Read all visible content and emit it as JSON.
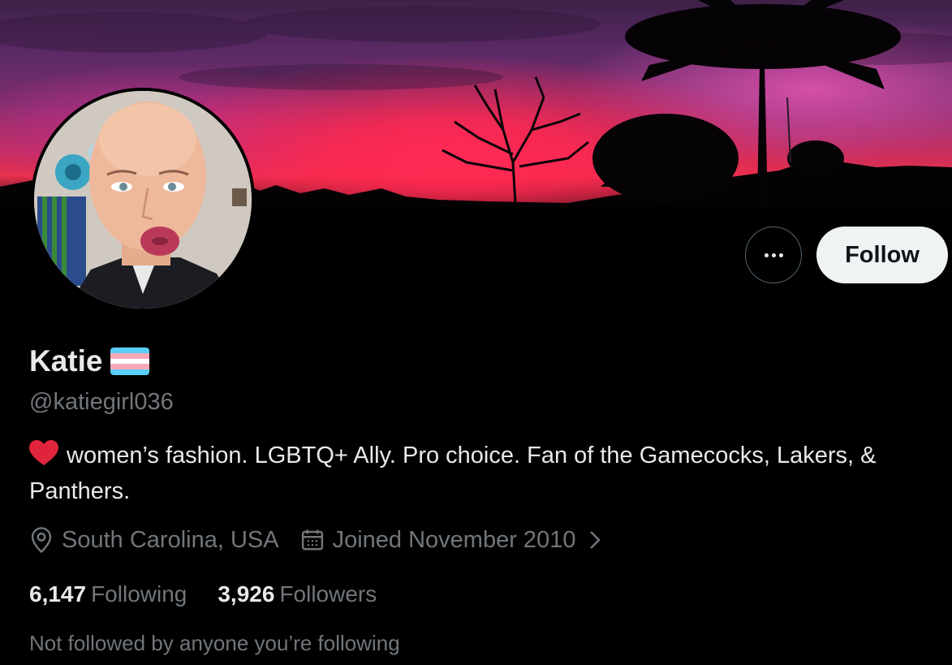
{
  "profile": {
    "display_name": "Katie",
    "name_badge": "transgender-flag-emoji",
    "handle": "@katiegirl036",
    "bio_icon": "red-heart-emoji",
    "bio": "women’s fashion. LGBTQ+ Ally. Pro choice. Fan of the Gamecocks, Lakers, & Panthers.",
    "location": "South Carolina, USA",
    "joined": "Joined November 2010"
  },
  "actions": {
    "more_icon": "more-horizontal-icon",
    "follow_label": "Follow"
  },
  "stats": {
    "following_count": "6,147",
    "following_label": "Following",
    "followers_count": "3,926",
    "followers_label": "Followers"
  },
  "followed_by": "Not followed by anyone you’re following",
  "colors": {
    "background": "#000000",
    "text_primary": "#e7e9ea",
    "text_secondary": "#71767b",
    "follow_button_bg": "#eff3f4",
    "heart": "#e0243b",
    "flag_blue": "#5bcefa",
    "flag_pink": "#f5a9b8",
    "flag_white": "#ffffff"
  }
}
